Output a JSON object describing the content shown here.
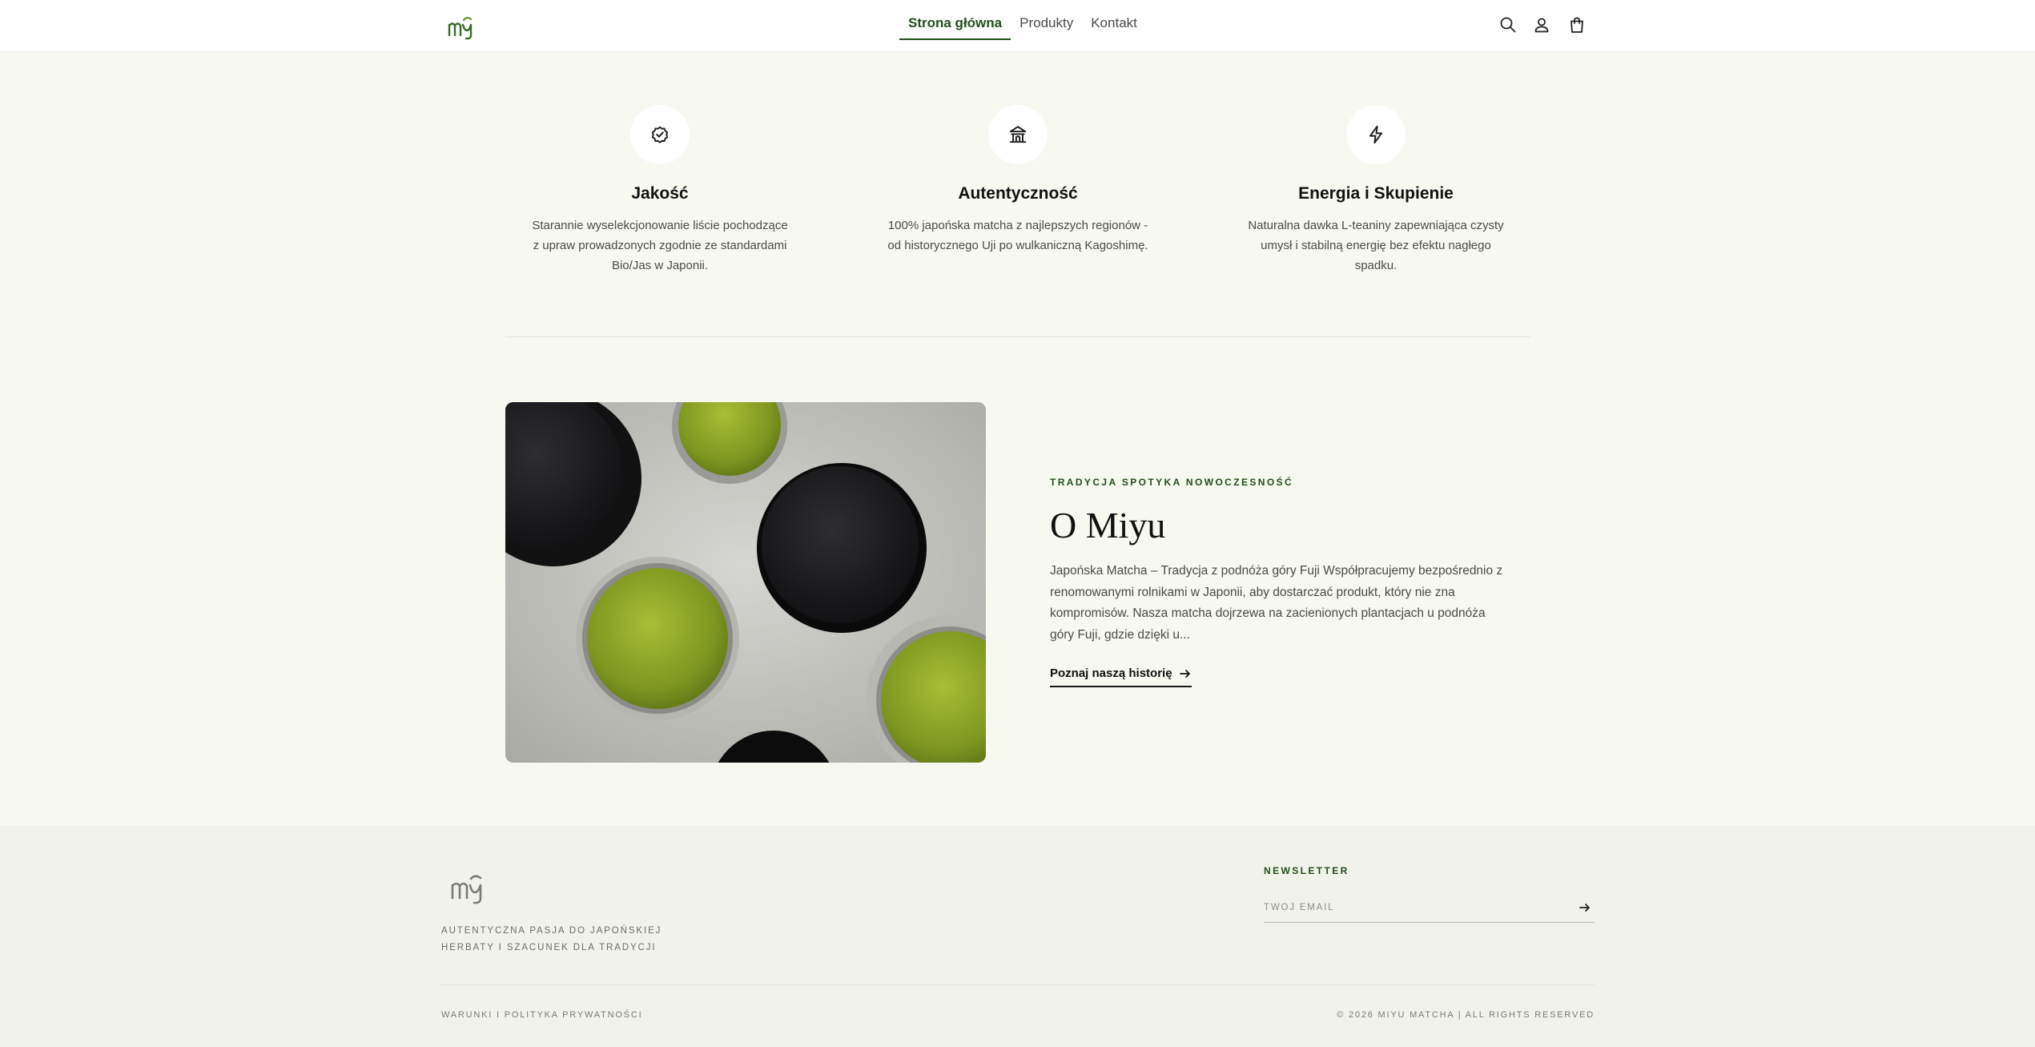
{
  "brand": {
    "logo_text": "miyu",
    "accent_color": "#234d1c"
  },
  "header": {
    "nav": [
      {
        "label": "Strona główna",
        "active": true
      },
      {
        "label": "Produkty",
        "active": false
      },
      {
        "label": "Kontakt",
        "active": false
      }
    ],
    "icons": [
      "search-icon",
      "user-icon",
      "shopping-bag-icon"
    ]
  },
  "features": [
    {
      "icon": "badge-check-icon",
      "title": "Jakość",
      "text": "Starannie wyselekcjonowanie liście pochodzące z upraw prowadzonych zgodnie ze standardami Bio/Jas w Japonii."
    },
    {
      "icon": "temple-icon",
      "title": "Autentyczność",
      "text": "100% japońska matcha z najlepszych regionów - od historycznego Uji po wulkaniczną Kagoshimę."
    },
    {
      "icon": "lightning-icon",
      "title": "Energia i Skupienie",
      "text": "Naturalna dawka L-teaniny zapewniająca czysty umysł i stabilną energię bez efektu nagłego spadku."
    }
  ],
  "about": {
    "eyebrow": "TRADYCJA SPOTYKA NOWOCZESNOŚĆ",
    "title": "O Miyu",
    "text": "Japońska Matcha – Tradycja z podnóża góry Fuji Współpracujemy bezpośrednio z renomowanymi rolnikami w Japonii, aby dostarczać produkt, który nie zna kompromisów. Nasza matcha dojrzewa na zacienionych plantacjach u podnóża góry Fuji, gdzie dzięki u...",
    "link_label": "Poznaj naszą historię"
  },
  "footer": {
    "tagline": "AUTENTYCZNA PASJA DO JAPOŃSKIEJ HERBATY I SZACUNEK DLA TRADYCJI",
    "newsletter_label": "NEWSLETTER",
    "newsletter_placeholder": "TWÓJ EMAIL",
    "legal_link": "WARUNKI I POLITYKA PRYWATNOŚCI",
    "copyright": "© 2026 MIYU MATCHA | ALL RIGHTS RESERVED"
  }
}
